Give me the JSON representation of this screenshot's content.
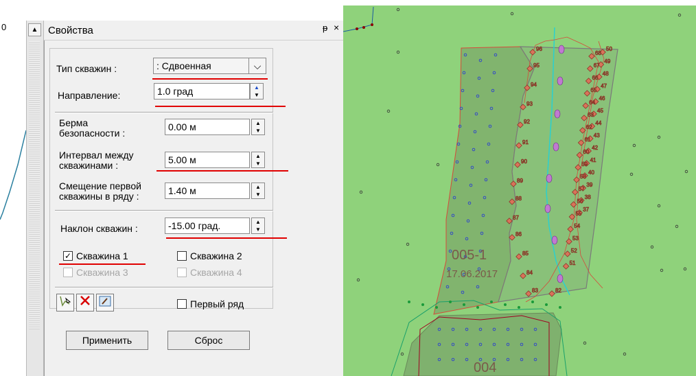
{
  "left_strip": {
    "label": "0"
  },
  "panel": {
    "title": "Свойства",
    "pin_glyph": "ᵖ",
    "close_glyph": "×",
    "well_type": {
      "label": "Тип скважин :",
      "value": ": Сдвоенная"
    },
    "direction": {
      "label": "Направление:",
      "value": "1.0 град"
    },
    "safety_berm": {
      "label_line1": "Берма",
      "label_line2": "безопасности :",
      "value": "0.00 м"
    },
    "well_interval": {
      "label_line1": "Интервал между",
      "label_line2": "скважинами :",
      "value": "5.00 м"
    },
    "first_offset": {
      "label_line1": "Смещение первой",
      "label_line2": "скважины в ряду :",
      "value": "1.40 м"
    },
    "inclination": {
      "label": "Наклон скважин :",
      "value": "-15.00 град."
    },
    "checkboxes": [
      {
        "label": "Скважина 1",
        "checked": true,
        "enabled": true
      },
      {
        "label": "Скважина 2",
        "checked": false,
        "enabled": true
      },
      {
        "label": "Скважина 3",
        "checked": false,
        "enabled": false
      },
      {
        "label": "Скважина 4",
        "checked": false,
        "enabled": false
      }
    ],
    "first_row": {
      "label": "Первый ряд",
      "checked": false
    },
    "apply_label": "Применить",
    "reset_label": "Сброс",
    "icons": [
      "select-polygon-icon",
      "delete-icon",
      "edit-icon"
    ]
  },
  "map": {
    "block_a": {
      "name": "005-1",
      "date": "17.06.2017"
    },
    "block_b": {
      "name": "004"
    },
    "hole_numbers_left": [
      "96",
      "95",
      "94",
      "93",
      "92",
      "91",
      "90",
      "89",
      "88",
      "87",
      "86",
      "85",
      "84",
      "83",
      "82"
    ],
    "hole_numbers_right": [
      "50",
      "49",
      "48",
      "47",
      "46",
      "45",
      "44",
      "43",
      "42",
      "41",
      "40",
      "39",
      "38",
      "37",
      "68",
      "67",
      "66",
      "65",
      "64",
      "63",
      "62",
      "61",
      "60",
      "59",
      "58",
      "57",
      "56",
      "55",
      "54",
      "53",
      "52",
      "51"
    ],
    "colors": {
      "background": "#8fd27b",
      "block_fill": "#7aa66a",
      "hole": "#d9735a",
      "blue_dot": "#2c3fd0",
      "red_line": "#e00000"
    }
  }
}
